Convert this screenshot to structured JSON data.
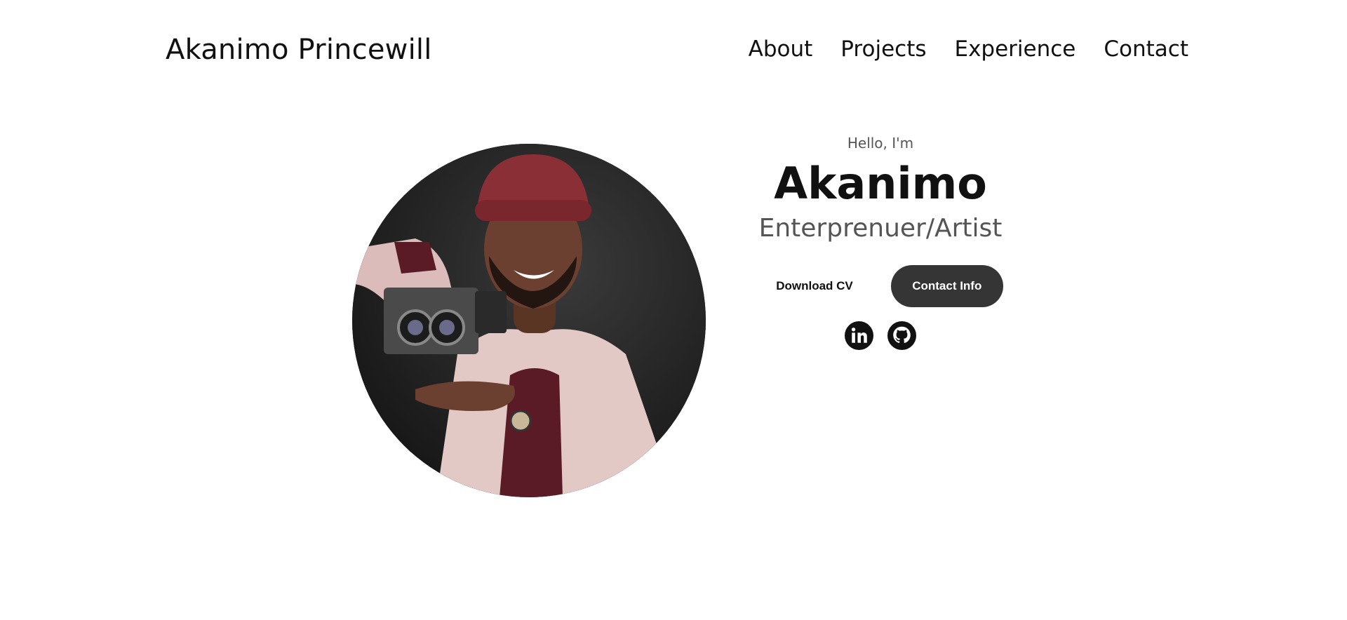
{
  "header": {
    "logo": "Akanimo Princewill",
    "nav": [
      "About",
      "Projects",
      "Experience",
      "Contact"
    ]
  },
  "hero": {
    "greeting": "Hello, I'm",
    "name": "Akanimo",
    "role": "Enterprenuer/Artist",
    "buttons": {
      "download_cv": "Download CV",
      "contact_info": "Contact Info"
    },
    "socials": [
      {
        "icon": "linkedin-icon"
      },
      {
        "icon": "github-icon"
      }
    ]
  },
  "colors": {
    "background": "#ffffff",
    "text": "#111111",
    "muted": "#555555",
    "button_dark": "#353535"
  }
}
